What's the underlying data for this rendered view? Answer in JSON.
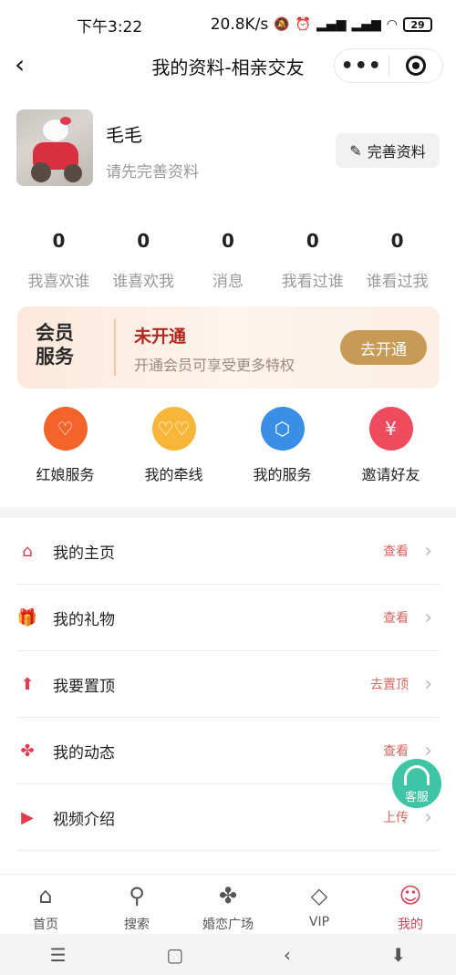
{
  "status": {
    "time": "下午3:22",
    "net_speed": "20.8K/s",
    "icons": [
      "mute-icon",
      "alarm-icon",
      "hd-signal-icon",
      "hd-signal-icon",
      "wifi-icon"
    ],
    "battery": "29"
  },
  "nav": {
    "title": "我的资料-相亲交友",
    "more_icon": "•••"
  },
  "profile": {
    "name": "毛毛",
    "subtitle": "请先完善资料",
    "edit_label": "完善资料"
  },
  "stats": [
    {
      "value": "0",
      "label": "我喜欢谁"
    },
    {
      "value": "0",
      "label": "谁喜欢我"
    },
    {
      "value": "0",
      "label": "消息"
    },
    {
      "value": "0",
      "label": "我看过谁"
    },
    {
      "value": "0",
      "label": "谁看过我"
    }
  ],
  "member": {
    "badge_line1": "会员",
    "badge_line2": "服务",
    "status": "未开通",
    "description": "开通会员可享受更多特权",
    "button": "去开通"
  },
  "quick": [
    {
      "label": "红娘服务",
      "icon": "heart-icon",
      "color": "#f2642a"
    },
    {
      "label": "我的牵线",
      "icon": "hearts-icon",
      "color": "#f7b63a"
    },
    {
      "label": "我的服务",
      "icon": "cube-icon",
      "color": "#3a8ee6"
    },
    {
      "label": "邀请好友",
      "icon": "yen-icon",
      "color": "#ef4b5e"
    }
  ],
  "menu": [
    {
      "label": "我的主页",
      "action": "查看",
      "icon": "home-icon"
    },
    {
      "label": "我的礼物",
      "action": "查看",
      "icon": "gift-icon"
    },
    {
      "label": "我要置顶",
      "action": "去置顶",
      "icon": "pin-top-icon"
    },
    {
      "label": "我的动态",
      "action": "查看",
      "icon": "pinwheel-icon"
    },
    {
      "label": "视频介绍",
      "action": "上传",
      "icon": "video-icon"
    }
  ],
  "service_label": "客服",
  "tabs": [
    {
      "label": "首页",
      "icon": "home-icon"
    },
    {
      "label": "搜索",
      "icon": "search-icon"
    },
    {
      "label": "婚恋广场",
      "icon": "pinwheel-icon"
    },
    {
      "label": "VIP",
      "icon": "diamond-icon"
    },
    {
      "label": "我的",
      "icon": "smile-icon",
      "active": true
    }
  ],
  "colors": {
    "accent": "#e23b50",
    "member_button": "#c79a55",
    "member_status": "#b2291e",
    "service": "#3fc5a6"
  }
}
